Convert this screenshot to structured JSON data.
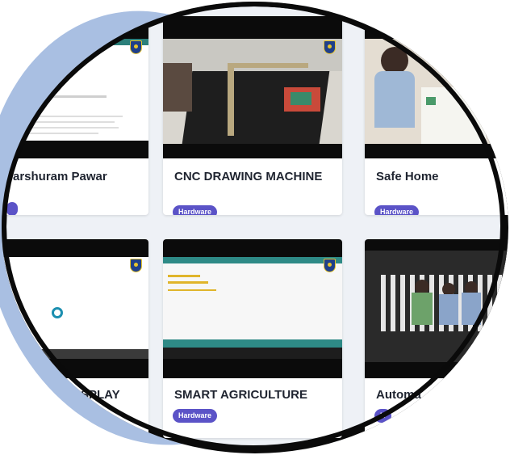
{
  "cards": [
    {
      "title": "arshuram Pawar",
      "badge": ""
    },
    {
      "title": "CNC DRAWING MACHINE",
      "badge": "Hardware"
    },
    {
      "title": "Safe Home",
      "badge": "Hardware"
    },
    {
      "title": "SPLAY",
      "badge": ""
    },
    {
      "title": "SMART AGRICULTURE",
      "badge": "Hardware"
    },
    {
      "title": "Automa",
      "badge": "H"
    }
  ],
  "colors": {
    "blob": "#a9bfe2",
    "badge": "#5b53c7",
    "frame": "#0a0a0a",
    "page": "#eef1f6"
  }
}
